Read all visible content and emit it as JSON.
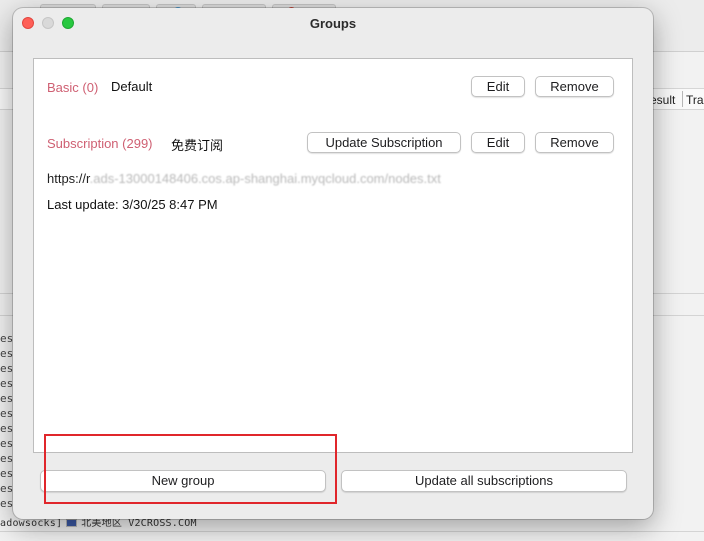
{
  "background": {
    "column_headers": [
      "esult",
      "Tra"
    ],
    "log_prefix": [
      "es",
      "es",
      "es",
      "es",
      "es",
      "es",
      "es",
      "es",
      "es",
      "es",
      "es",
      "es"
    ],
    "bottom_text_left": "adowsocks]",
    "bottom_text_right": "北美地区 V2CROSS.COM"
  },
  "window": {
    "title": "Groups"
  },
  "groups": [
    {
      "name": "Basic (0)",
      "alias": "Default",
      "edit_label": "Edit",
      "remove_label": "Remove"
    },
    {
      "name": "Subscription (299)",
      "alias": "免费订阅",
      "update_label": "Update Subscription",
      "edit_label": "Edit",
      "remove_label": "Remove",
      "url_visible": "https://r",
      "url_obscured": ".ads-13000148406.cos.ap-shanghai.myqcloud.com/nodes.txt",
      "last_update": "Last update: 3/30/25 8:47 PM"
    }
  ],
  "footer": {
    "new_group_label": "New group",
    "update_all_label": "Update all subscriptions"
  },
  "colors": {
    "group_name": "#cf6073",
    "highlight": "#e0262b"
  }
}
